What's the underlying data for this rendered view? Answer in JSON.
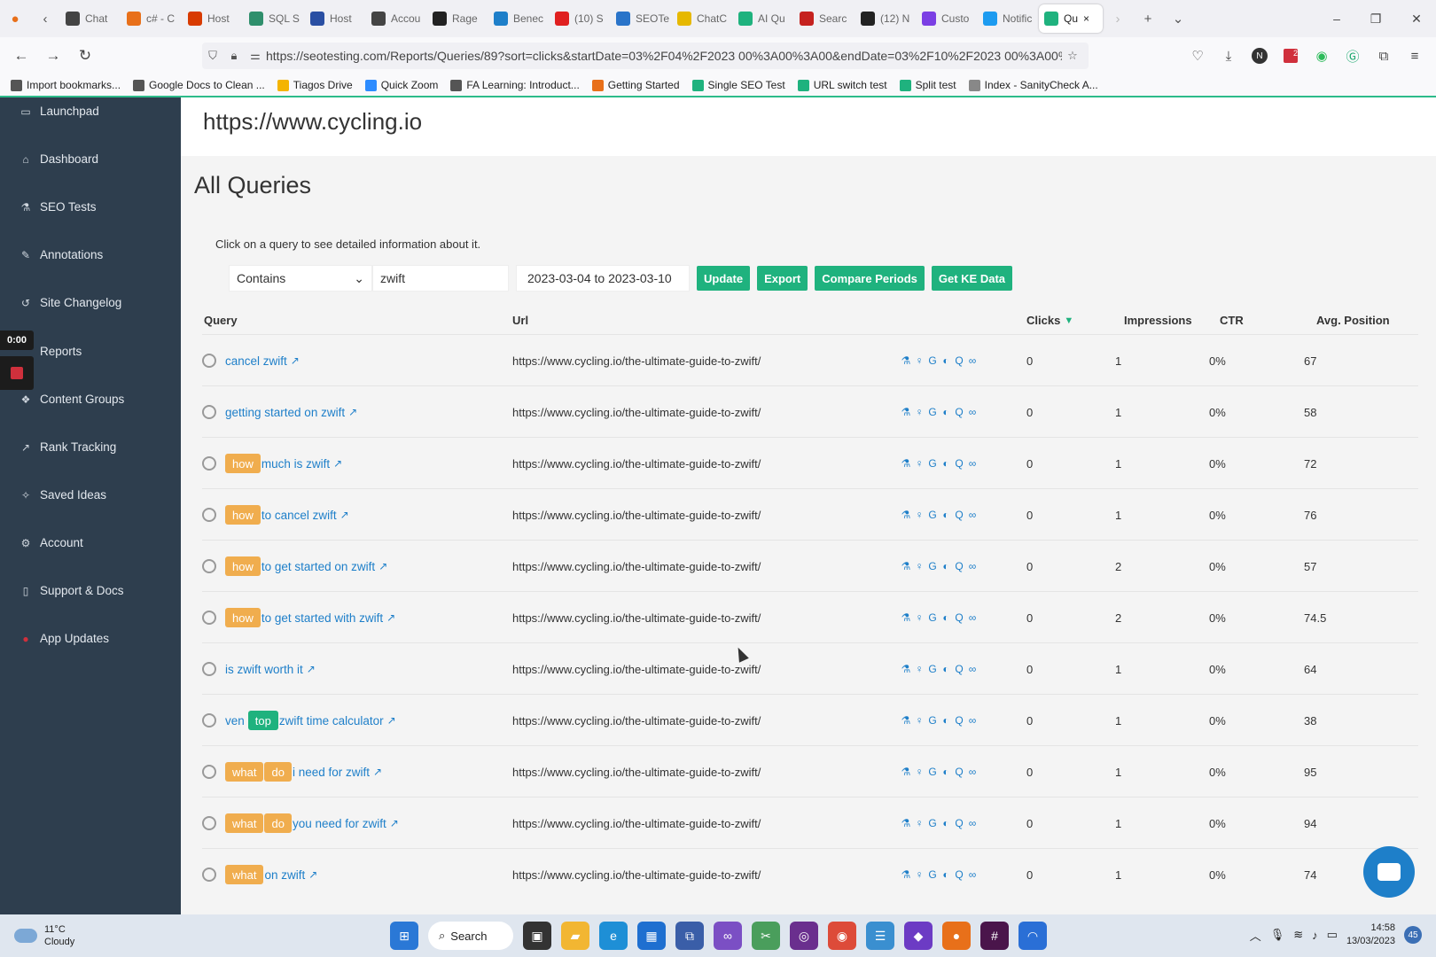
{
  "browser": {
    "tabs": [
      {
        "title": "Chat",
        "color": "#444444"
      },
      {
        "title": "c# - C",
        "color": "#e8701a"
      },
      {
        "title": "Host",
        "color": "#d83b01"
      },
      {
        "title": "SQL S",
        "color": "#2f8f6c"
      },
      {
        "title": "Host",
        "color": "#2a4fa3"
      },
      {
        "title": "Accou",
        "color": "#444444"
      },
      {
        "title": "Rage",
        "color": "#222222"
      },
      {
        "title": "Benec",
        "color": "#1e7fc9"
      },
      {
        "title": "(10) S",
        "color": "#e02020"
      },
      {
        "title": "SEOTe",
        "color": "#2a74c9"
      },
      {
        "title": "ChatC",
        "color": "#e6b800"
      },
      {
        "title": "AI Qu",
        "color": "#1fb27e"
      },
      {
        "title": "Searc",
        "color": "#c5221f"
      },
      {
        "title": "(12) N",
        "color": "#222222"
      },
      {
        "title": "Custo",
        "color": "#7b3fe4"
      },
      {
        "title": "Notific",
        "color": "#1d9bf0"
      }
    ],
    "active_tab": {
      "title": "Qu",
      "color": "#1fb27e"
    },
    "url": "https://seotesting.com/Reports/Queries/89?sort=clicks&startDate=03%2F04%2F2023 00%3A00%3A00&endDate=03%2F10%2F2023 00%3A00%3A0",
    "bookmarks": [
      {
        "label": "Import bookmarks...",
        "color": "#555555"
      },
      {
        "label": "Google Docs to Clean ...",
        "color": "#555555"
      },
      {
        "label": "Tiagos Drive",
        "color": "#f4b400"
      },
      {
        "label": "Quick Zoom",
        "color": "#2d8cff"
      },
      {
        "label": "FA Learning: Introduct...",
        "color": "#555555"
      },
      {
        "label": "Getting Started",
        "color": "#e8701a"
      },
      {
        "label": "Single SEO Test",
        "color": "#1fb27e"
      },
      {
        "label": "URL switch test",
        "color": "#1fb27e"
      },
      {
        "label": "Split test",
        "color": "#1fb27e"
      },
      {
        "label": "Index - SanityCheck A...",
        "color": "#888888"
      }
    ],
    "extension_badge": "2"
  },
  "sidebar": {
    "items": [
      {
        "label": "Launchpad",
        "icon": "monitor-icon",
        "glyph": "▭"
      },
      {
        "label": "Dashboard",
        "icon": "home-icon",
        "glyph": "⌂"
      },
      {
        "label": "SEO Tests",
        "icon": "flask-icon",
        "glyph": "⚗"
      },
      {
        "label": "Annotations",
        "icon": "pencil-icon",
        "glyph": "✎"
      },
      {
        "label": "Site Changelog",
        "icon": "history-icon",
        "glyph": "↺"
      },
      {
        "label": "Reports",
        "icon": "chart-icon",
        "glyph": "▤"
      },
      {
        "label": "Content Groups",
        "icon": "folder-icon",
        "glyph": "❖"
      },
      {
        "label": "Rank Tracking",
        "icon": "trend-icon",
        "glyph": "↗"
      },
      {
        "label": "Saved Ideas",
        "icon": "bulb-icon",
        "glyph": "✧"
      },
      {
        "label": "Account",
        "icon": "gear-icon",
        "glyph": "⚙"
      },
      {
        "label": "Support & Docs",
        "icon": "book-icon",
        "glyph": "▯"
      },
      {
        "label": "App Updates",
        "icon": "alert-icon",
        "glyph": "●"
      }
    ],
    "recording_time": "0:00"
  },
  "page": {
    "site_url": "https://www.cycling.io",
    "title": "All Queries",
    "hint": "Click on a query to see detailed information about it.",
    "filter": {
      "match_type": "Contains",
      "query": "zwift",
      "date_range": "2023-03-04 to 2023-03-10"
    },
    "buttons": {
      "update": "Update",
      "export": "Export",
      "compare": "Compare Periods",
      "ke": "Get KE Data"
    },
    "columns": {
      "query": "Query",
      "url": "Url",
      "clicks": "Clicks",
      "impressions": "Impressions",
      "ctr": "CTR",
      "avg_position": "Avg. Position"
    }
  },
  "rows": [
    {
      "tags": [],
      "text": "cancel zwift",
      "url": "https://www.cycling.io/the-ultimate-guide-to-zwift/",
      "clicks": "0",
      "impressions": "1",
      "ctr": "0%",
      "position": "67"
    },
    {
      "tags": [],
      "text": "getting started on zwift",
      "url": "https://www.cycling.io/the-ultimate-guide-to-zwift/",
      "clicks": "0",
      "impressions": "1",
      "ctr": "0%",
      "position": "58"
    },
    {
      "tags": [
        {
          "label": "how",
          "kind": "orange"
        }
      ],
      "text": "much is zwift",
      "url": "https://www.cycling.io/the-ultimate-guide-to-zwift/",
      "clicks": "0",
      "impressions": "1",
      "ctr": "0%",
      "position": "72"
    },
    {
      "tags": [
        {
          "label": "how",
          "kind": "orange"
        }
      ],
      "text": "to cancel zwift",
      "url": "https://www.cycling.io/the-ultimate-guide-to-zwift/",
      "clicks": "0",
      "impressions": "1",
      "ctr": "0%",
      "position": "76"
    },
    {
      "tags": [
        {
          "label": "how",
          "kind": "orange"
        }
      ],
      "text": "to get started on zwift",
      "url": "https://www.cycling.io/the-ultimate-guide-to-zwift/",
      "clicks": "0",
      "impressions": "2",
      "ctr": "0%",
      "position": "57"
    },
    {
      "tags": [
        {
          "label": "how",
          "kind": "orange"
        }
      ],
      "text": "to get started with zwift",
      "url": "https://www.cycling.io/the-ultimate-guide-to-zwift/",
      "clicks": "0",
      "impressions": "2",
      "ctr": "0%",
      "position": "74.5"
    },
    {
      "tags": [],
      "text": "is zwift worth it",
      "url": "https://www.cycling.io/the-ultimate-guide-to-zwift/",
      "clicks": "0",
      "impressions": "1",
      "ctr": "0%",
      "position": "64"
    },
    {
      "tags": [
        {
          "label": "top",
          "kind": "green"
        }
      ],
      "prefix": "ven",
      "text": "zwift time calculator",
      "url": "https://www.cycling.io/the-ultimate-guide-to-zwift/",
      "clicks": "0",
      "impressions": "1",
      "ctr": "0%",
      "position": "38"
    },
    {
      "tags": [
        {
          "label": "what",
          "kind": "orange"
        },
        {
          "label": "do",
          "kind": "orange"
        }
      ],
      "text": "i need for zwift",
      "url": "https://www.cycling.io/the-ultimate-guide-to-zwift/",
      "clicks": "0",
      "impressions": "1",
      "ctr": "0%",
      "position": "95"
    },
    {
      "tags": [
        {
          "label": "what",
          "kind": "orange"
        },
        {
          "label": "do",
          "kind": "orange"
        }
      ],
      "text": "you need for zwift",
      "url": "https://www.cycling.io/the-ultimate-guide-to-zwift/",
      "clicks": "0",
      "impressions": "1",
      "ctr": "0%",
      "position": "94"
    },
    {
      "tags": [
        {
          "label": "what",
          "kind": "orange"
        }
      ],
      "text": "on zwift",
      "url": "https://www.cycling.io/the-ultimate-guide-to-zwift/",
      "clicks": "0",
      "impressions": "1",
      "ctr": "0%",
      "position": "74"
    }
  ],
  "taskbar": {
    "temperature": "11°C",
    "weather": "Cloudy",
    "search": "Search",
    "time": "14:58",
    "date": "13/03/2023",
    "notifications": "45"
  },
  "colors": {
    "sidebar": "#2e3e4e",
    "accent": "#1fb27e",
    "tag_orange": "#f0ad4e",
    "link": "#1e7fc9"
  }
}
